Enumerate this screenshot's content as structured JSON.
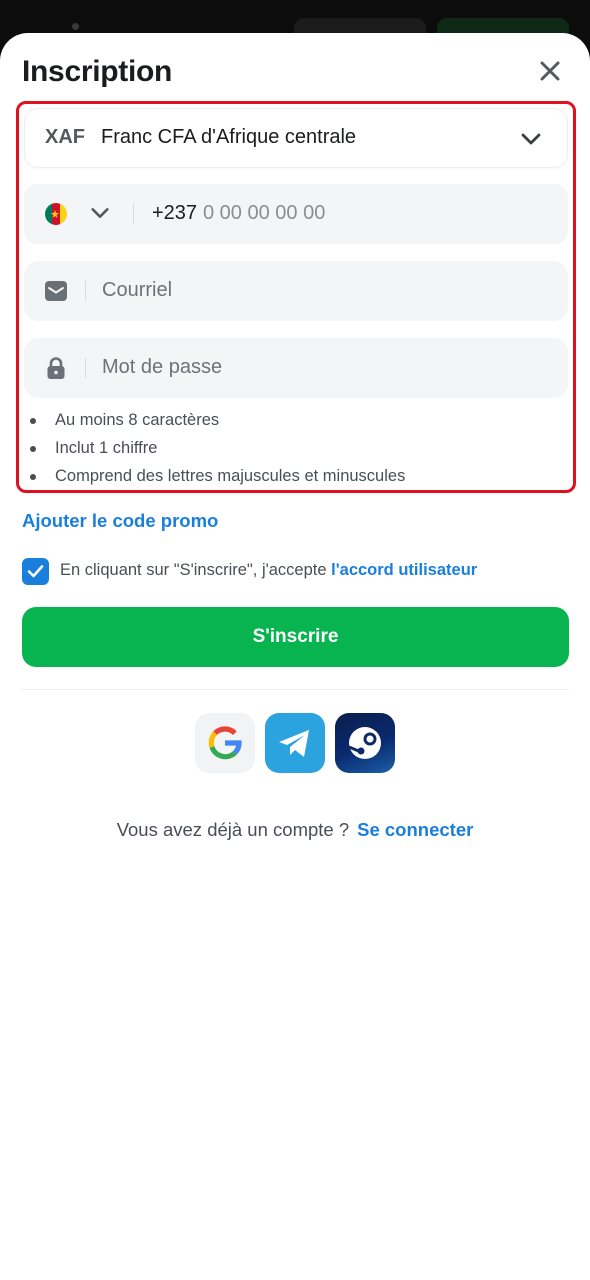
{
  "modal": {
    "title": "Inscription"
  },
  "currency": {
    "code": "XAF",
    "name": "Franc CFA d'Afrique centrale"
  },
  "phone": {
    "country_code": "+237",
    "placeholder": "0 00 00 00 00",
    "flag_colors": [
      "#007a5e",
      "#ce1126",
      "#fcd116"
    ]
  },
  "email": {
    "placeholder": "Courriel"
  },
  "password": {
    "placeholder": "Mot de passe",
    "rules": [
      "Au moins 8 caractères",
      "Inclut 1 chiffre",
      "Comprend des lettres majuscules et minuscules"
    ]
  },
  "promo": {
    "label": "Ajouter le code promo"
  },
  "terms": {
    "text": "En cliquant sur \"S'inscrire\", j'accepte ",
    "link": "l'accord utilisateur",
    "checked": true
  },
  "signup_button": {
    "label": "S'inscrire"
  },
  "social": {
    "google": "google-icon",
    "telegram": "telegram-icon",
    "steam": "steam-icon"
  },
  "login": {
    "prompt": "Vous avez déjà un compte ?",
    "link": "Se connecter"
  },
  "colors": {
    "accent_blue": "#1a7fdc",
    "primary_green": "#07b44f",
    "highlight_red": "#e0101e"
  }
}
